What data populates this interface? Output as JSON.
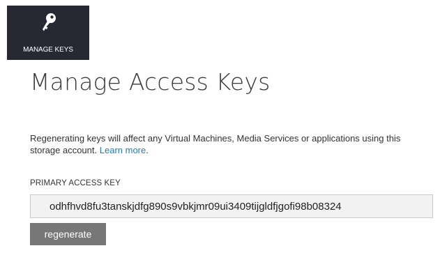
{
  "toolbar": {
    "manage_keys_label": "MANAGE KEYS",
    "manage_keys_icon": "key-icon"
  },
  "main": {
    "title": "Manage Access Keys",
    "description": "Regenerating keys will affect any Virtual Machines, Media Services or applications using this storage account.",
    "learn_more_label": "Learn more",
    "description_suffix": ".",
    "primary_key_label": "PRIMARY ACCESS KEY",
    "primary_key_value": "odhfhvd8fu3tanskjdfg890s9vbkjmr09ui3409tijgldfjgofi98b08324",
    "regenerate_label": "regenerate"
  },
  "colors": {
    "toolbar_background": "#262932",
    "link": "#1e7cbf",
    "button_background": "#777777",
    "field_background": "#f2f2f2"
  }
}
